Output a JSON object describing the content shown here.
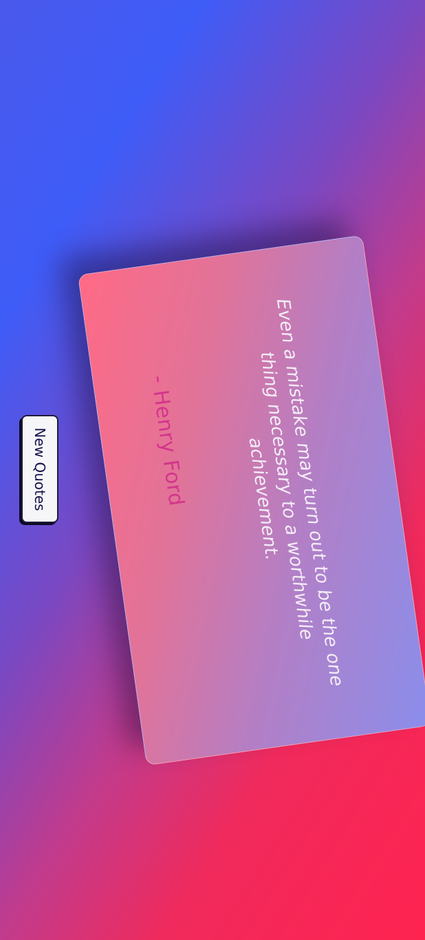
{
  "quote": {
    "text": "Even a mistake may turn out to be the one thing necessary to a worthwhile achievement.",
    "author": "- Henry Ford"
  },
  "button": {
    "label": "New Quotes"
  },
  "colors": {
    "gradient_start": "#3e5cf7",
    "gradient_end": "#ff2350",
    "author_color": "#d3358b",
    "button_text": "#14124a"
  }
}
